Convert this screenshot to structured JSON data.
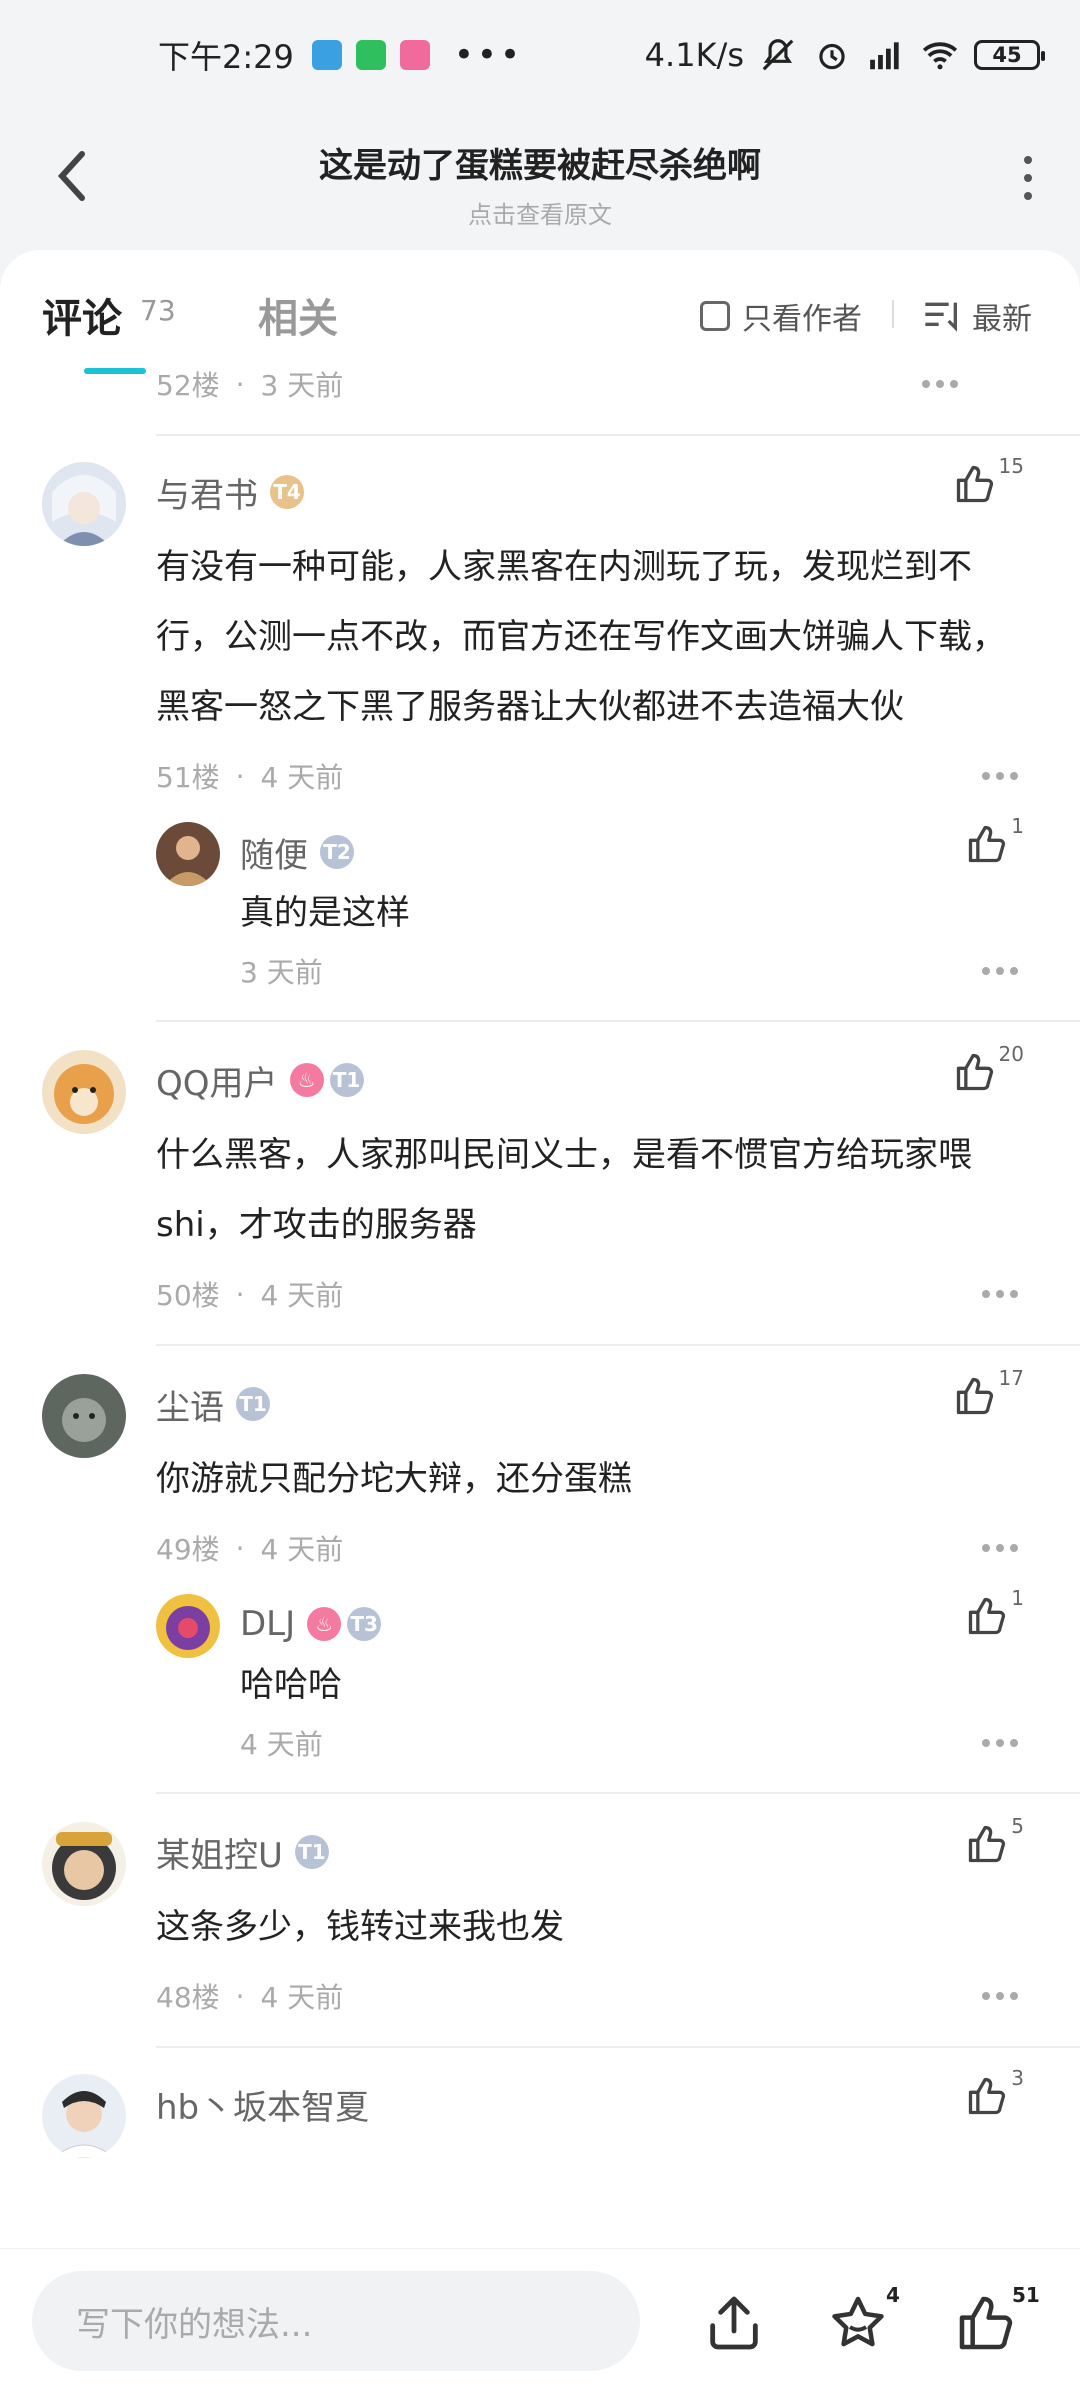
{
  "status_bar": {
    "time": "下午2:29",
    "speed": "4.1K/s",
    "network": "HD",
    "battery": "45"
  },
  "header": {
    "title": "这是动了蛋糕要被赶尽杀绝啊",
    "subtitle": "点击查看原文"
  },
  "tabs": {
    "comments_label": "评论",
    "comments_count": "73",
    "related_label": "相关",
    "author_only_label": "只看作者",
    "sort_label": "最新"
  },
  "top_partial": {
    "floor": "52楼",
    "time": "3 天前"
  },
  "comments": [
    {
      "name": "与君书",
      "badge": "T4",
      "likes": "15",
      "text": "有没有一种可能，人家黑客在内测玩了玩，发现烂到不行，公测一点不改，而官方还在写作文画大饼骗人下载，黑客一怒之下黑了服务器让大伙都进不去造福大伙",
      "floor": "51楼",
      "time": "4 天前",
      "reply": {
        "name": "随便",
        "badge": "T2",
        "likes": "1",
        "text": "真的是这样",
        "time": "3 天前"
      }
    },
    {
      "name": "QQ用户",
      "badge": "T1",
      "likes": "20",
      "text": "什么黑客，人家那叫民间义士，是看不惯官方给玩家喂shi，才攻击的服务器",
      "floor": "50楼",
      "time": "4 天前"
    },
    {
      "name": "尘语",
      "badge": "T1",
      "likes": "17",
      "text": "你游就只配分坨大辩，还分蛋糕",
      "floor": "49楼",
      "time": "4 天前",
      "reply": {
        "name": "DLJ",
        "badge": "T3",
        "likes": "1",
        "text": "哈哈哈",
        "time": "4 天前"
      }
    },
    {
      "name": "某姐控U",
      "badge": "T1",
      "likes": "5",
      "text": "这条多少，钱转过来我也发",
      "floor": "48楼",
      "time": "4 天前"
    },
    {
      "name": "hb丶坂本智夏",
      "likes": "3"
    }
  ],
  "bottom_bar": {
    "input_placeholder": "写下你的想法...",
    "star_count": "4",
    "like_count": "51"
  },
  "colors": {
    "accent": "#19c2d4",
    "background": "#f3f4f6"
  },
  "icons": [
    "back-icon",
    "more-icon",
    "checkbox-icon",
    "sort-icon",
    "thumb-up-icon",
    "ellipsis-icon",
    "share-icon",
    "star-icon"
  ]
}
